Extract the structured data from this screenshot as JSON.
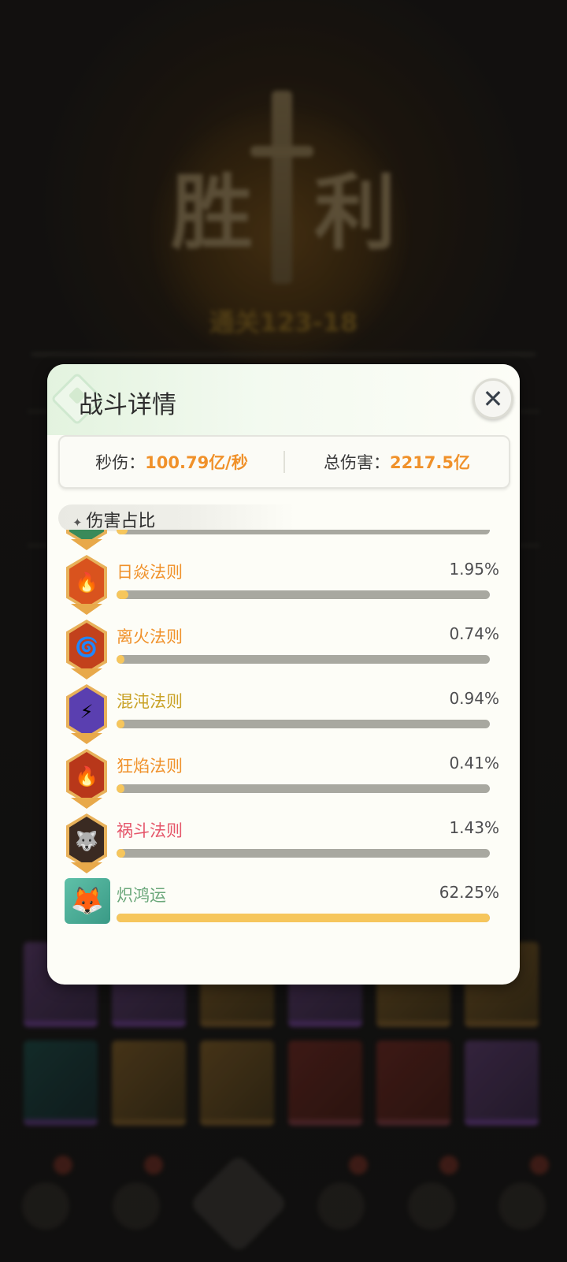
{
  "background": {
    "victory_title": "胜利",
    "stage_text": "通关123-18"
  },
  "modal": {
    "title": "战斗详情",
    "close_icon": "close-x-icon",
    "stats": {
      "dps_label": "秒伤：",
      "dps_value": "100.79亿/秒",
      "total_label": "总伤害：",
      "total_value": "2217.5亿"
    },
    "section_title": "伤害占比",
    "rows": [
      {
        "name": "",
        "percent": "",
        "fraction": 0.03,
        "name_color": "#f0912a",
        "badge_color": "#3a8a5a",
        "icon": "leaf-icon",
        "emoji": "🌿"
      },
      {
        "name": "日焱法则",
        "percent": "1.95%",
        "fraction": 0.0313,
        "name_color": "#f0912a",
        "badge_color": "#d9531e",
        "icon": "sun-flame-icon",
        "emoji": "🔥"
      },
      {
        "name": "离火法则",
        "percent": "0.74%",
        "fraction": 0.0119,
        "name_color": "#f0912a",
        "badge_color": "#c2411c",
        "icon": "phoenix-fire-icon",
        "emoji": "🌀"
      },
      {
        "name": "混沌法则",
        "percent": "0.94%",
        "fraction": 0.0151,
        "name_color": "#c9a227",
        "badge_color": "#5a3fb0",
        "icon": "chaos-figure-icon",
        "emoji": "⚡"
      },
      {
        "name": "狂焰法则",
        "percent": "0.41%",
        "fraction": 0.0066,
        "name_color": "#f0912a",
        "badge_color": "#b8371a",
        "icon": "bonfire-icon",
        "emoji": "🔥"
      },
      {
        "name": "祸斗法则",
        "percent": "1.43%",
        "fraction": 0.023,
        "name_color": "#e5566a",
        "badge_color": "#3a2a22",
        "icon": "howling-beast-icon",
        "emoji": "🐺"
      },
      {
        "name": "炽鸿运",
        "percent": "62.25%",
        "fraction": 1.0,
        "name_color": "#6aa77a",
        "badge_color": "#4fb09a",
        "icon": "orange-fox-avatar-icon",
        "emoji": "🦊",
        "square": true
      }
    ]
  }
}
